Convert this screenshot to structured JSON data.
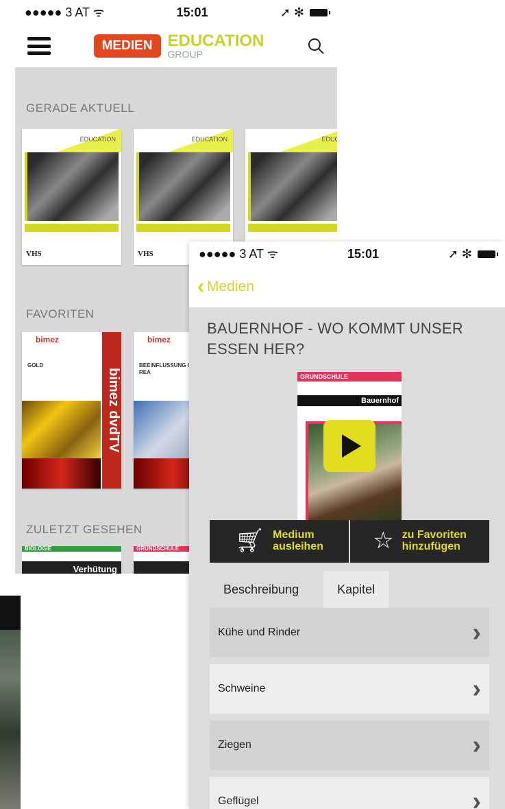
{
  "back_screen": {
    "status": {
      "carrier": "●●●●● 3 AT ᯤ",
      "time": "15:01",
      "right": "➚ ✻"
    },
    "logo": {
      "medien": "MEDIEN",
      "education": "EDUCATION",
      "group": "GROUP"
    },
    "sections": {
      "current": "GERADE AKTUELL",
      "favorites": "FAVORITEN",
      "recent": "ZULETZT GESEHEN"
    },
    "vhs_items": [
      {
        "brand": "EDUCATION",
        "foot": "VHS"
      },
      {
        "brand": "EDUCATION",
        "foot": "VHS"
      },
      {
        "brand": "EDUC",
        "foot": ""
      }
    ],
    "fav_items": [
      {
        "brand": "bimez",
        "subtitle": "GOLD",
        "side": "bimez dvdTV"
      },
      {
        "brand": "bimez",
        "subtitle": "BEEINFLUSSUNG CHEMISCHER REA",
        "side": ""
      }
    ],
    "recent_items": [
      {
        "category": "BIOLOGIE",
        "title": "Verhütung",
        "color": "#2e9e3e"
      },
      {
        "category": "GRUNDSCHULE",
        "title": "",
        "color": "#e6335a"
      }
    ]
  },
  "front_screen": {
    "status": {
      "carrier": "●●●●● 3 AT ᯤ",
      "time": "15:01",
      "right": "➚ ✻"
    },
    "back_label": "Medien",
    "title": "BAUERNHOF - WO KOMMT UNSER ESSEN HER?",
    "cover": {
      "category": "GRUNDSCHULE",
      "title": "Bauernhof"
    },
    "actions": [
      {
        "icon": "cart-icon",
        "label_1": "Medium",
        "label_2": "ausleihen"
      },
      {
        "icon": "star-icon",
        "label_1": "zu Favoriten",
        "label_2": "hinzufügen"
      }
    ],
    "tabs": [
      "Beschreibung",
      "Kapitel"
    ],
    "active_tab": "Kapitel",
    "chapters": [
      "Kühe und Rinder",
      "Schweine",
      "Ziegen",
      "Geflügel"
    ]
  },
  "colors": {
    "accent": "#e2dc1e",
    "medien": "#e5461d",
    "education": "#c9d22a"
  }
}
